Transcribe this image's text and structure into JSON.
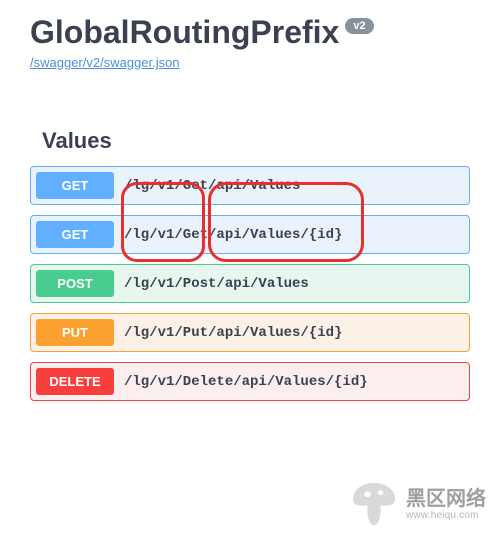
{
  "header": {
    "title": "GlobalRoutingPrefix",
    "version_badge": "v2",
    "swagger_link": "/swagger/v2/swagger.json"
  },
  "section": {
    "name": "Values"
  },
  "operations": [
    {
      "method": "GET",
      "path": "/lg/v1/Get/api/Values"
    },
    {
      "method": "GET",
      "path": "/lg/v1/Get/api/Values/{id}"
    },
    {
      "method": "POST",
      "path": "/lg/v1/Post/api/Values"
    },
    {
      "method": "PUT",
      "path": "/lg/v1/Put/api/Values/{id}"
    },
    {
      "method": "DELETE",
      "path": "/lg/v1/Delete/api/Values/{id}"
    }
  ],
  "colors": {
    "get": "#61affe",
    "post": "#49cc90",
    "put": "#fca130",
    "delete": "#f93e3e"
  },
  "watermark": {
    "cn": "黑区网络",
    "en": "www.heiqu.com"
  }
}
